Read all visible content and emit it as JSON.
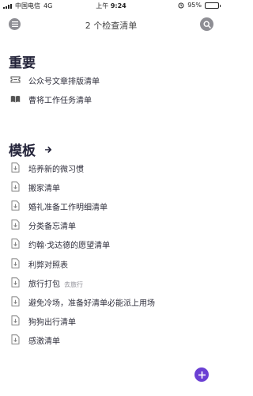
{
  "status_bar": {
    "carrier": "中国电信",
    "network": "4G",
    "time_prefix": "上午",
    "time": "9:24",
    "battery": "95%"
  },
  "nav": {
    "title": "2 个检查清单",
    "menu_icon": "menu-icon",
    "search_icon": "search-icon"
  },
  "important": {
    "title": "重要",
    "items": [
      {
        "label": "公众号文章排版清单",
        "icon": "ticket-icon"
      },
      {
        "label": "曹将工作任务清单",
        "icon": "book-icon"
      }
    ]
  },
  "templates": {
    "title": "模板",
    "arrow_icon": "arrow-right-icon",
    "items": [
      {
        "label": "培养新的微习惯",
        "icon": "download-doc-icon",
        "tag": ""
      },
      {
        "label": "搬家清单",
        "icon": "download-doc-icon",
        "tag": ""
      },
      {
        "label": "婚礼准备工作明细清单",
        "icon": "download-doc-icon",
        "tag": ""
      },
      {
        "label": "分类备忘清单",
        "icon": "download-doc-icon",
        "tag": ""
      },
      {
        "label": "约翰·戈达德的愿望清单",
        "icon": "download-doc-icon",
        "tag": ""
      },
      {
        "label": "利弊对照表",
        "icon": "download-doc-icon",
        "tag": ""
      },
      {
        "label": "旅行打包",
        "icon": "download-doc-icon",
        "tag": "去旅行"
      },
      {
        "label": "避免冷场，准备好清单必能派上用场",
        "icon": "download-doc-icon",
        "tag": ""
      },
      {
        "label": "狗狗出行清单",
        "icon": "download-doc-icon",
        "tag": ""
      },
      {
        "label": "感激清单",
        "icon": "download-doc-icon",
        "tag": ""
      }
    ]
  },
  "fab": {
    "icon": "plus-icon",
    "color": "#6a3fd3"
  }
}
